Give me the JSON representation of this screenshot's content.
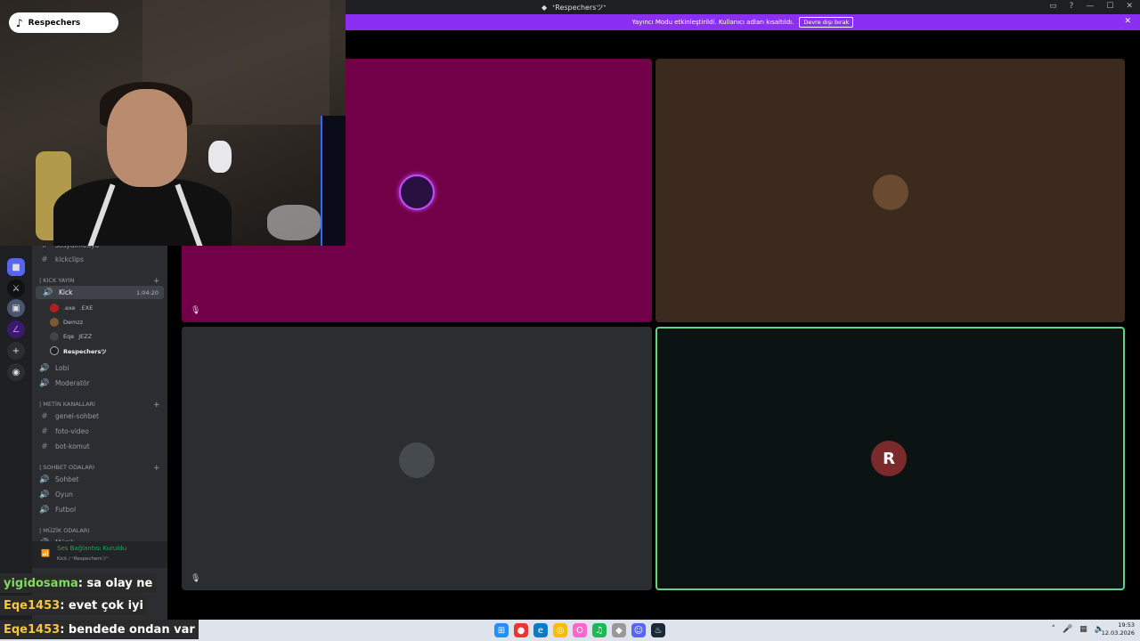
{
  "window": {
    "title": "ᐩRespechersツᐩ",
    "controls": [
      "▭",
      "?",
      "—",
      "☐",
      "✕"
    ]
  },
  "notice": {
    "text": "Yayıncı Modu etkinleştirildi. Kullanıcı adları kısaltıldı.",
    "button": "Devre dışı bırak",
    "close": "✕"
  },
  "overlay": {
    "tiktok_name": "Respechers"
  },
  "sidebar": {
    "top_partial": "sosyalmedya",
    "kickclips": "kickclips",
    "cat_kick": "| Kick Yayın",
    "kick_channel": "Kick",
    "kick_time": "1:04:20",
    "members": [
      {
        "name": ".exe",
        "tag": ".EXE"
      },
      {
        "name": "Demzz",
        "tag": ""
      },
      {
        "name": "Eqe",
        "tag": "JEZZ"
      },
      {
        "name": "Respechersツ",
        "tag": ""
      }
    ],
    "lobi": "Lobi",
    "moderator": "Moderatör",
    "cat_metin": "| METİN KANALLARI",
    "genel_sohbet": "genel-sohbet",
    "foto_video": "foto-video",
    "bot_komut": "bot-komut",
    "cat_sohbet": "| SOHBET ODALARI",
    "sohbet": "Sohbet",
    "oyun": "Oyun",
    "futbol": "Futbol",
    "cat_muzik": "| MÜZİK ODALARI",
    "muzik": "Müzik"
  },
  "voice": {
    "status": "Ses Bağlantısı Kuruldu",
    "channel": "Kick / ᐩRespechersツᐩ"
  },
  "chat": [
    {
      "nick": "yigidosama",
      "msg": " : sa olay ne"
    },
    {
      "nick": "Eqe1453",
      "msg": " : evet çok iyi"
    },
    {
      "nick": "Eqe1453",
      "msg": " : bendede ondan var"
    }
  ],
  "clock": {
    "time": "19:53",
    "date": "12.03.2026"
  },
  "colors": {
    "tile_magenta": "#720048",
    "tile_brown": "#3d2a1e",
    "tile_gray": "#2b2e31",
    "tile_dark": "#0b1412",
    "speaking": "#5fd38a"
  }
}
